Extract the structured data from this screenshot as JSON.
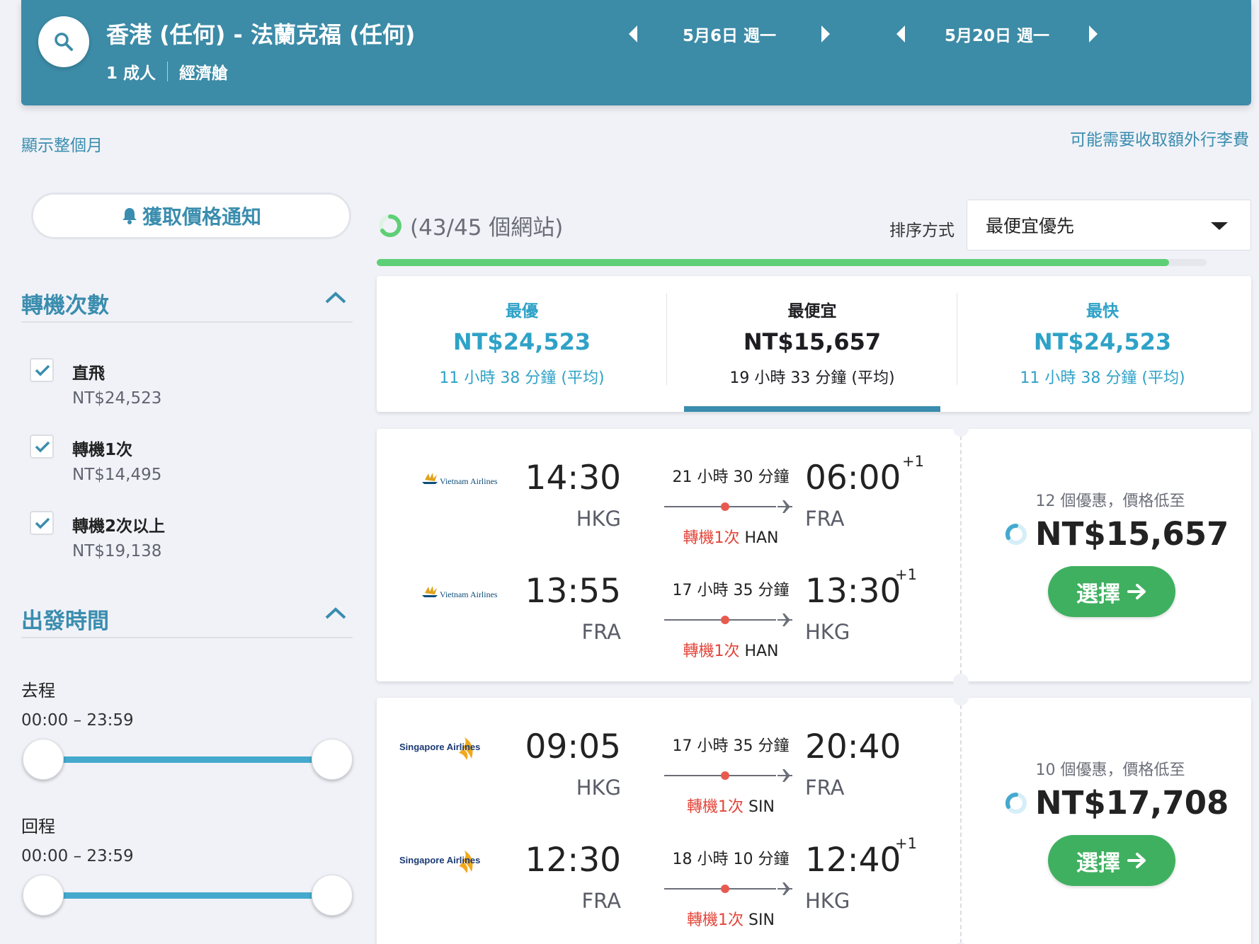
{
  "search": {
    "route": "香港 (任何) - 法蘭克福 (任何)",
    "passengers": "1 成人",
    "cabin": "經濟艙",
    "depart_date": "5月6日 週一",
    "return_date": "5月20日 週一"
  },
  "links": {
    "show_month": "顯示整個月",
    "baggage_note": "可能需要收取額外行李費"
  },
  "sidebar": {
    "price_alert": "獲取價格通知",
    "stops_title": "轉機次數",
    "stops": [
      {
        "label": "直飛",
        "price": "NT$24,523",
        "checked": true
      },
      {
        "label": "轉機1次",
        "price": "NT$14,495",
        "checked": true
      },
      {
        "label": "轉機2次以上",
        "price": "NT$19,138",
        "checked": true
      }
    ],
    "time_title": "出發時間",
    "outbound_label": "去程",
    "outbound_range": "00:00 – 23:59",
    "return_label": "回程",
    "return_range": "00:00 – 23:59"
  },
  "results_header": {
    "site_count": "(43/45 個網站)",
    "sort_label": "排序方式",
    "sort_value": "最便宜優先",
    "progress": 0.955
  },
  "tabs": [
    {
      "title": "最優",
      "price": "NT$24,523",
      "duration": "11 小時 38 分鐘 (平均)"
    },
    {
      "title": "最便宜",
      "price": "NT$15,657",
      "duration": "19 小時 33 分鐘 (平均)",
      "active": true
    },
    {
      "title": "最快",
      "price": "NT$24,523",
      "duration": "11 小時 38 分鐘 (平均)"
    }
  ],
  "results": [
    {
      "airline": "Vietnam Airlines",
      "legs": [
        {
          "dep_time": "14:30",
          "dep_code": "HKG",
          "duration": "21 小時 30 分鐘",
          "stops": "轉機1次",
          "via": "HAN",
          "arr_time": "06:00",
          "arr_code": "FRA",
          "plus": "+1"
        },
        {
          "dep_time": "13:55",
          "dep_code": "FRA",
          "duration": "17 小時 35 分鐘",
          "stops": "轉機1次",
          "via": "HAN",
          "arr_time": "13:30",
          "arr_code": "HKG",
          "plus": "+1"
        }
      ],
      "deals": "12 個優惠，價格低至",
      "price": "NT$15,657",
      "select": "選擇"
    },
    {
      "airline": "Singapore Airlines",
      "legs": [
        {
          "dep_time": "09:05",
          "dep_code": "HKG",
          "duration": "17 小時 35 分鐘",
          "stops": "轉機1次",
          "via": "SIN",
          "arr_time": "20:40",
          "arr_code": "FRA",
          "plus": ""
        },
        {
          "dep_time": "12:30",
          "dep_code": "FRA",
          "duration": "18 小時 10 分鐘",
          "stops": "轉機1次",
          "via": "SIN",
          "arr_time": "12:40",
          "arr_code": "HKG",
          "plus": "+1"
        }
      ],
      "deals": "10 個優惠，價格低至",
      "price": "NT$17,708",
      "select": "選擇"
    }
  ],
  "colors": {
    "header_bg": "#3c8ba7",
    "accent_blue": "#3a8dae",
    "select_green": "#3fb060",
    "stop_red": "#e3453a",
    "progress_green": "#5fcf77"
  }
}
